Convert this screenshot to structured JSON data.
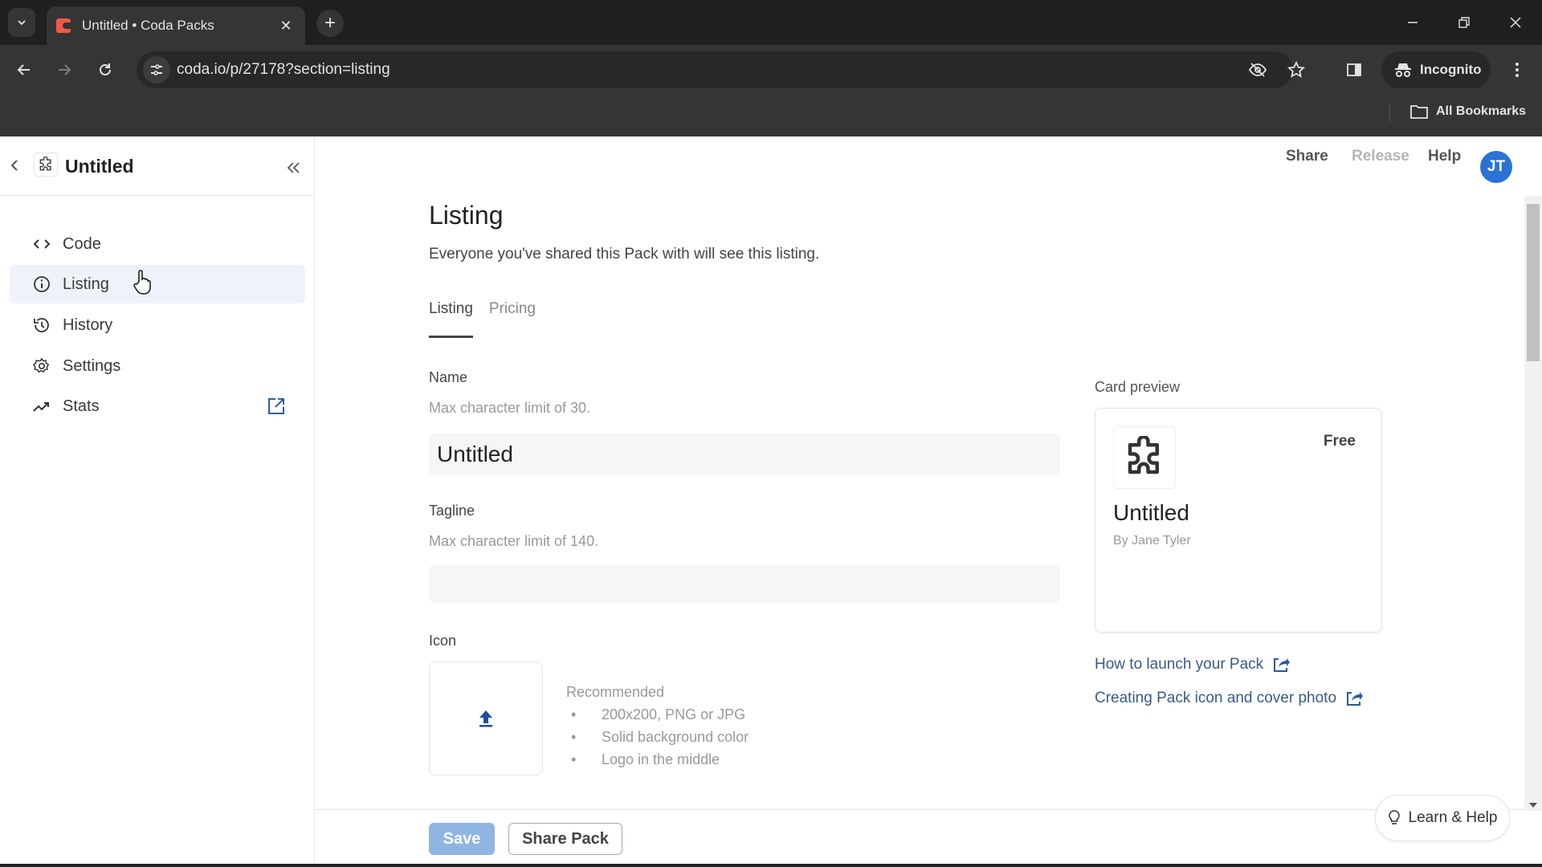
{
  "browser": {
    "tab_title": "Untitled • Coda Packs",
    "url": "coda.io/p/27178?section=listing",
    "incognito_label": "Incognito",
    "bookmarks_label": "All Bookmarks"
  },
  "sidebar": {
    "title": "Untitled",
    "items": [
      {
        "label": "Code",
        "icon": "code-icon"
      },
      {
        "label": "Listing",
        "icon": "info-icon",
        "active": true
      },
      {
        "label": "History",
        "icon": "history-icon"
      },
      {
        "label": "Settings",
        "icon": "gear-icon"
      },
      {
        "label": "Stats",
        "icon": "trending-icon"
      }
    ]
  },
  "header": {
    "share": "Share",
    "release": "Release",
    "help": "Help",
    "avatar_initials": "JT"
  },
  "main": {
    "title": "Listing",
    "description": "Everyone you've shared this Pack with will see this listing.",
    "tabs": [
      {
        "label": "Listing",
        "active": true
      },
      {
        "label": "Pricing",
        "active": false
      }
    ],
    "name_field": {
      "label": "Name",
      "help": "Max character limit of 30.",
      "value": "Untitled"
    },
    "tagline_field": {
      "label": "Tagline",
      "help": "Max character limit of 140.",
      "value": ""
    },
    "icon_field": {
      "label": "Icon",
      "recommended_title": "Recommended",
      "recommendations": [
        "200x200, PNG or JPG",
        "Solid background color",
        "Logo in the middle"
      ]
    },
    "card_preview": {
      "label": "Card preview",
      "price": "Free",
      "name": "Untitled",
      "author": "By Jane Tyler"
    },
    "links": [
      "How to launch your Pack",
      "Creating Pack icon and cover photo"
    ]
  },
  "footer": {
    "save": "Save",
    "share_pack": "Share Pack"
  },
  "learn_help": "Learn & Help",
  "colors": {
    "accent": "#2a72d5",
    "save_disabled": "#8fb6e3",
    "link": "#3a5a8a",
    "active_nav_bg": "#eef3fb"
  }
}
